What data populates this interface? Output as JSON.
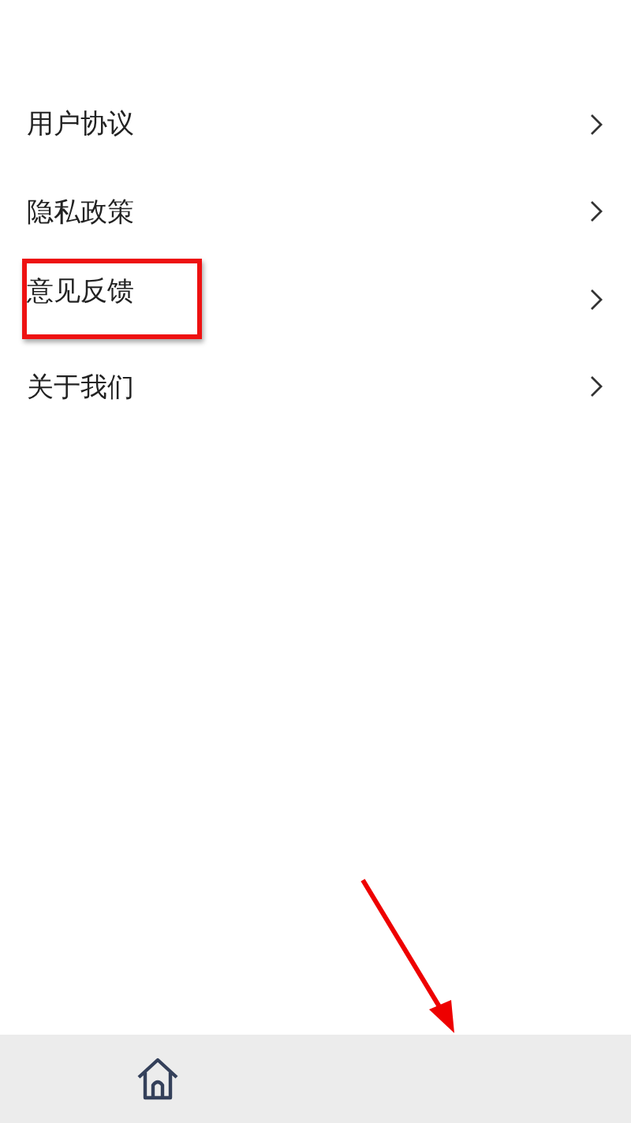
{
  "menu_items": [
    {
      "label": "用户协议",
      "highlighted": false
    },
    {
      "label": "隐私政策",
      "highlighted": false
    },
    {
      "label": "意见反馈",
      "highlighted": true
    },
    {
      "label": "关于我们",
      "highlighted": false
    }
  ],
  "pointer_arrow": true,
  "tab_bar": {
    "tabs": [
      {
        "kind": "home"
      }
    ]
  }
}
